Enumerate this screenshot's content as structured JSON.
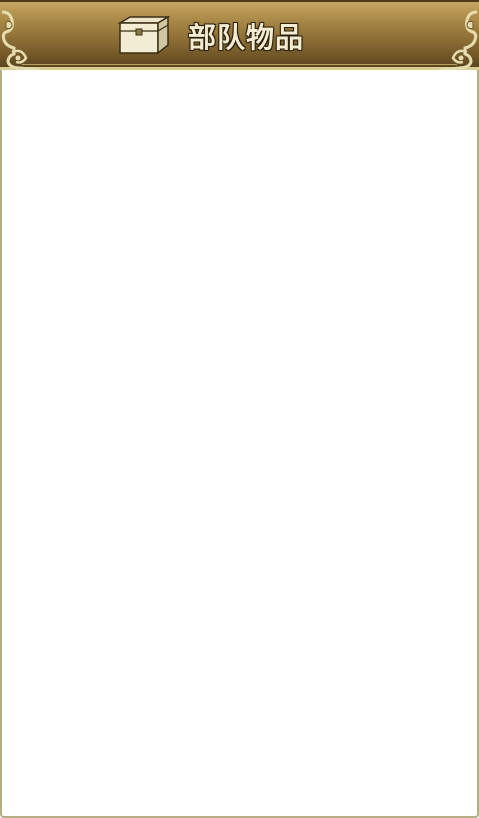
{
  "header": {
    "title": "部队物品",
    "icon": "treasure-chest-icon"
  },
  "colors": {
    "header_top": "#c8a661",
    "header_bottom": "#5a4420",
    "title_text": "#f4ecd0",
    "frame_border": "#b7ad83",
    "content_background": "#ffffff"
  },
  "content": {
    "items": []
  }
}
